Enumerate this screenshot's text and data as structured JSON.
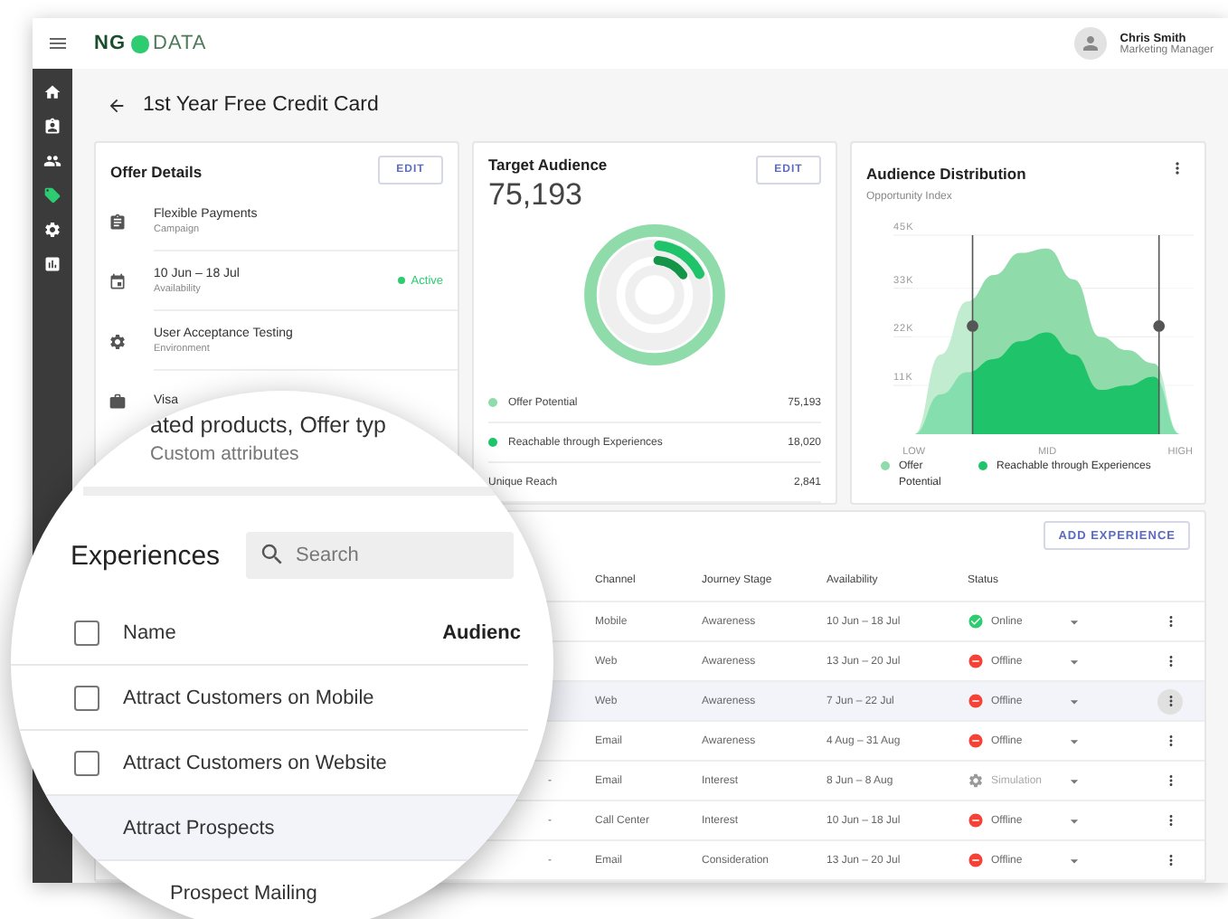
{
  "app": {
    "logo_left": "NG",
    "logo_right": "DATA"
  },
  "user": {
    "name": "Chris Smith",
    "role": "Marketing Manager"
  },
  "sidebar": {
    "items": [
      {
        "selected": false
      },
      {
        "selected": false
      },
      {
        "selected": false
      },
      {
        "selected": true
      },
      {
        "selected": false
      },
      {
        "selected": false
      }
    ]
  },
  "page_title": "1st Year Free Credit Card",
  "offer_details": {
    "title": "Offer Details",
    "edit": "EDIT",
    "items": [
      {
        "title": "Flexible Payments",
        "subtitle": "Campaign"
      },
      {
        "title": "10 Jun – 18 Jul",
        "subtitle": "Availability",
        "badge": "Active"
      },
      {
        "title": "User Acceptance Testing",
        "subtitle": "Environment"
      },
      {
        "title": "Visa"
      }
    ]
  },
  "target_audience": {
    "title": "Target Audience",
    "edit": "EDIT",
    "total": "75,193",
    "legend": [
      {
        "label": "Offer Potential",
        "value": "75,193",
        "color": "#8fdcaa"
      },
      {
        "label": "Reachable through Experiences",
        "value": "18,020",
        "color": "#1fc46a"
      },
      {
        "label": "Unique Reach",
        "value": "2,841"
      }
    ]
  },
  "audience_distribution": {
    "title": "Audience Distribution",
    "subtitle": "Opportunity Index",
    "chart_data": {
      "type": "area",
      "grid": true,
      "categories": [
        "LOW",
        null,
        null,
        null,
        null,
        "MID",
        null,
        null,
        null,
        null,
        "HIGH"
      ],
      "ylim": [
        0,
        45000
      ],
      "yticks": [
        {
          "value": 11000,
          "label": "11K"
        },
        {
          "value": 22000,
          "label": "22K"
        },
        {
          "value": 33000,
          "label": "33K"
        },
        {
          "value": 45000,
          "label": "45K"
        }
      ],
      "series": [
        {
          "name": "Offer Potential",
          "color": "#8fdcaa",
          "values": [
            0,
            18000,
            30000,
            36000,
            41000,
            42000,
            35000,
            22000,
            19000,
            16000,
            0
          ]
        },
        {
          "name": "Reachable through Experiences",
          "color": "#1fc46a",
          "values": [
            0,
            9000,
            14000,
            17000,
            21000,
            23000,
            18000,
            10000,
            11000,
            13000,
            0
          ]
        }
      ]
    }
  },
  "experiences": {
    "add_button": "ADD EXPERIENCE",
    "columns": [
      "Channel",
      "Journey Stage",
      "Availability",
      "Status"
    ],
    "rows": [
      {
        "channel": "Mobile",
        "stage": "Awareness",
        "availability": "10 Jun – 18 Jul",
        "status": {
          "kind": "online",
          "label": "Online"
        },
        "selected": false
      },
      {
        "channel": "Web",
        "stage": "Awareness",
        "availability": "13 Jun – 20 Jul",
        "status": {
          "kind": "offline",
          "label": "Offline"
        },
        "selected": false
      },
      {
        "channel": "Web",
        "stage": "Awareness",
        "availability": "7 Jun – 22 Jul",
        "status": {
          "kind": "offline",
          "label": "Offline"
        },
        "selected": true
      },
      {
        "channel": "Email",
        "stage": "Awareness",
        "availability": "4 Aug – 31 Aug",
        "status": {
          "kind": "offline",
          "label": "Offline"
        },
        "selected": false
      },
      {
        "audience": "-",
        "channel": "Email",
        "stage": "Interest",
        "availability": "8 Jun – 8 Aug",
        "status": {
          "kind": "simulation",
          "label": "Simulation"
        },
        "selected": false
      },
      {
        "audience": "-",
        "channel": "Call Center",
        "stage": "Interest",
        "availability": "10 Jun – 18 Jul",
        "status": {
          "kind": "offline",
          "label": "Offline"
        },
        "selected": false
      },
      {
        "audience": "-",
        "channel": "Email",
        "stage": "Consideration",
        "availability": "13 Jun – 20 Jul",
        "status": {
          "kind": "offline",
          "label": "Offline"
        },
        "selected": false
      }
    ]
  },
  "magnifier": {
    "offer_line": "ated products, Offer typ",
    "offer_sub": "Custom attributes",
    "title": "Experiences",
    "search": {
      "placeholder": "Search"
    },
    "columns": [
      "Name",
      "Audienc"
    ],
    "header_checked": false,
    "rows": [
      {
        "name": "Attract Customers on Mobile",
        "checked": false,
        "selected": false
      },
      {
        "name": "Attract Customers on Website",
        "checked": false,
        "selected": false
      },
      {
        "name": "Attract Prospects",
        "selected": true
      },
      {
        "name": "Prospect Mailing",
        "selected": false
      }
    ]
  }
}
